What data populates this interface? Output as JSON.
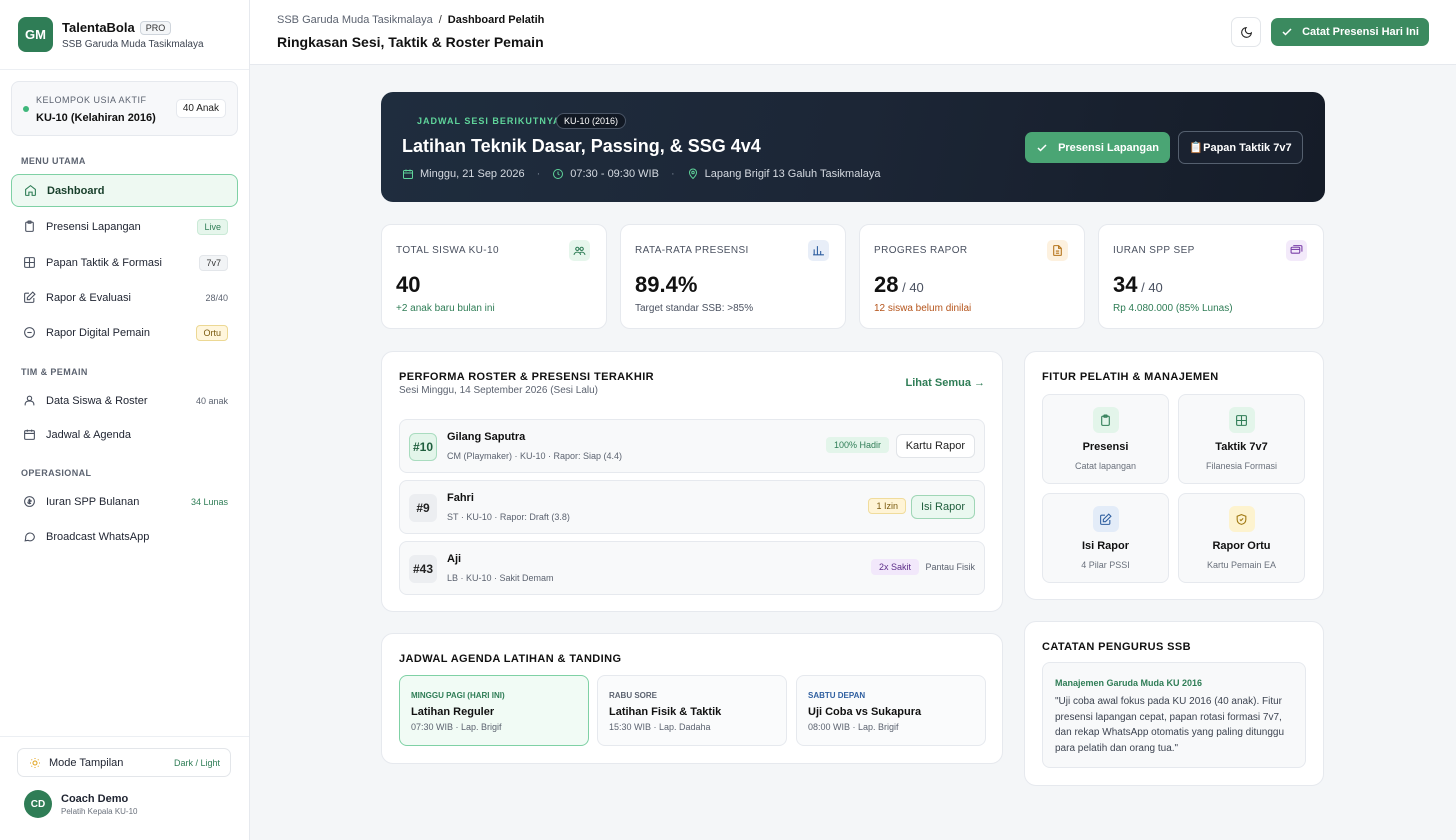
{
  "brand": {
    "initials": "GM",
    "name": "TalentaBola",
    "badge": "PRO",
    "subtitle": "SSB Garuda Muda Tasikmalaya"
  },
  "group": {
    "label": "KELOMPOK USIA AKTIF",
    "value": "KU-10 (Kelahiran 2016)",
    "count": "40 Anak"
  },
  "sections": {
    "main": "MENU UTAMA",
    "team": "TIM & PEMAIN",
    "ops": "OPERASIONAL"
  },
  "nav": [
    {
      "label": "Dashboard",
      "badge": ""
    },
    {
      "label": "Presensi Lapangan",
      "badge": "Live"
    },
    {
      "label": "Papan Taktik & Formasi",
      "badge": "7v7"
    },
    {
      "label": "Rapor & Evaluasi",
      "badge": "28/40"
    },
    {
      "label": "Rapor Digital Pemain",
      "badge": "Ortu"
    },
    {
      "label": "Data Siswa & Roster",
      "badge": "40 anak"
    },
    {
      "label": "Jadwal & Agenda",
      "badge": ""
    },
    {
      "label": "Iuran SPP Bulanan",
      "badge": "34 Lunas"
    },
    {
      "label": "Broadcast WhatsApp",
      "badge": ""
    }
  ],
  "mode": {
    "label": "Mode Tampilan",
    "value": "Dark / Light"
  },
  "user": {
    "initials": "CD",
    "name": "Coach Demo",
    "role": "Pelatih Kepala KU-10"
  },
  "header": {
    "crumb_parent": "SSB Garuda Muda Tasikmalaya",
    "crumb_sep": "/",
    "crumb_current": "Dashboard Pelatih",
    "title": "Ringkasan Sesi, Taktik & Roster Pemain",
    "primary_button": "Catat Presensi Hari Ini"
  },
  "hero": {
    "label": "JADWAL SESI BERIKUTNYA",
    "tag": "KU-10 (2016)",
    "title": "Latihan Teknik Dasar, Passing, & SSG 4v4",
    "date": "Minggu, 21 Sep 2026",
    "time": "07:30 - 09:30 WIB",
    "place": "Lapang Brigif 13 Galuh Tasikmalaya",
    "btn_presensi": "Presensi Lapangan",
    "btn_taktik": "📋Papan Taktik 7v7"
  },
  "stats": [
    {
      "label": "TOTAL SISWA KU-10",
      "value": "40",
      "suffix": "",
      "sub": "+2 anak baru bulan ini",
      "sub_color": "#2f7d56"
    },
    {
      "label": "RATA-RATA PRESENSI",
      "value": "89.4%",
      "suffix": "",
      "sub": "Target standar SSB: >85%",
      "sub_color": "#4a5160"
    },
    {
      "label": "PROGRES RAPOR",
      "value": "28",
      "suffix": " / 40",
      "sub": "12 siswa belum dinilai",
      "sub_color": "#b5541b"
    },
    {
      "label": "IURAN SPP SEP",
      "value": "34",
      "suffix": " / 40",
      "sub": "Rp 4.080.000 (85% Lunas)",
      "sub_color": "#2f7d56"
    }
  ],
  "roster": {
    "title": "PERFORMA ROSTER & PRESENSI TERAKHIR",
    "subtitle": "Sesi Minggu, 14 September 2026 (Sesi Lalu)",
    "see_all": "Lihat Semua →",
    "players": [
      {
        "number": "#10",
        "name": "Gilang Saputra",
        "detail": "CM (Playmaker) · KU-10 · Rapor: Siap (4.4)",
        "badge": "100% Hadir",
        "action": "Kartu Rapor"
      },
      {
        "number": "#9",
        "name": "Fahri",
        "detail": "ST · KU-10 · Rapor: Draft (3.8)",
        "badge": "1 Izin",
        "action": "Isi Rapor"
      },
      {
        "number": "#43",
        "name": "Aji",
        "detail": "LB · KU-10 · Sakit Demam",
        "badge": "2x Sakit",
        "action": "Pantau Fisik"
      }
    ]
  },
  "agenda": {
    "title": "JADWAL AGENDA LATIHAN & TANDING",
    "items": [
      {
        "when": "MINGGU PAGI (HARI INI)",
        "title": "Latihan Reguler",
        "meta": "07:30 WIB · Lap. Brigif"
      },
      {
        "when": "RABU SORE",
        "title": "Latihan Fisik & Taktik",
        "meta": "15:30 WIB · Lap. Dadaha"
      },
      {
        "when": "SABTU DEPAN",
        "title": "Uji Coba vs Sukapura",
        "meta": "08:00 WIB · Lap. Brigif"
      }
    ]
  },
  "features": {
    "title": "FITUR PELATIH & MANAJEMEN",
    "items": [
      {
        "title": "Presensi",
        "sub": "Catat lapangan"
      },
      {
        "title": "Taktik 7v7",
        "sub": "Filanesia Formasi"
      },
      {
        "title": "Isi Rapor",
        "sub": "4 Pilar PSSI"
      },
      {
        "title": "Rapor Ortu",
        "sub": "Kartu Pemain EA"
      }
    ]
  },
  "notes": {
    "title": "CATATAN PENGURUS SSB",
    "author": "Manajemen Garuda Muda KU 2016",
    "text": "\"Uji coba awal fokus pada KU 2016 (40 anak). Fitur presensi lapangan cepat, papan rotasi formasi 7v7, dan rekap WhatsApp otomatis yang paling ditunggu para pelatih dan orang tua.\""
  },
  "colors": {
    "accent": "#3b8a5f",
    "hero_bg": "#1c2636",
    "warning": "#b5541b"
  }
}
